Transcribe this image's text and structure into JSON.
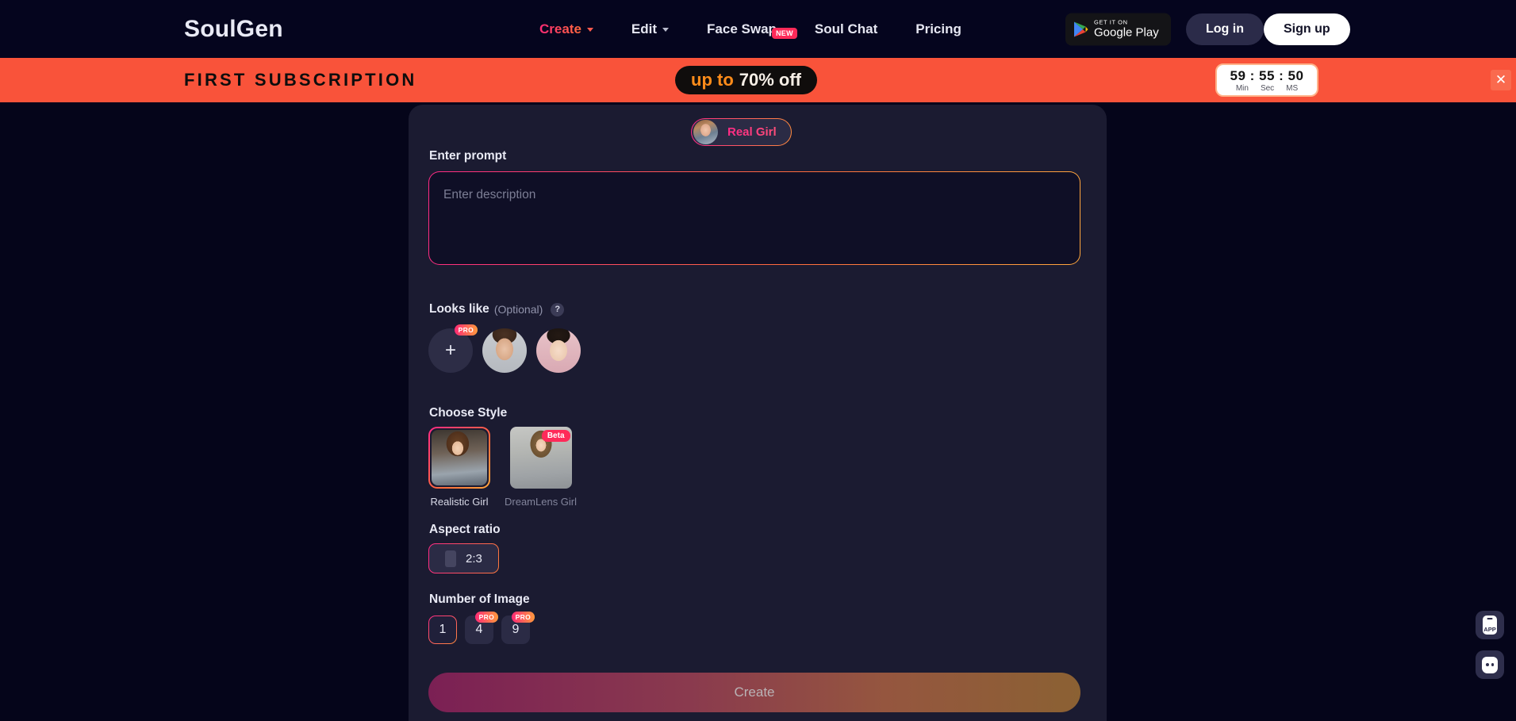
{
  "nav": {
    "brand": "SoulGen",
    "items": [
      {
        "label": "Create",
        "icon": "chevron-down-icon",
        "active": true,
        "badge": ""
      },
      {
        "label": "Edit",
        "icon": "chevron-down-icon",
        "active": false,
        "badge": ""
      },
      {
        "label": "Face Swap",
        "icon": "",
        "active": false,
        "badge": "NEW"
      },
      {
        "label": "Soul Chat",
        "icon": "",
        "active": false,
        "badge": ""
      },
      {
        "label": "Pricing",
        "icon": "",
        "active": false,
        "badge": ""
      }
    ],
    "google_play": {
      "small": "GET IT ON",
      "big": "Google Play",
      "icon": "google-play-icon"
    },
    "login": "Log in",
    "signup": "Sign up"
  },
  "promo": {
    "title": "FIRST SUBSCRIPTION",
    "pill_prefix": "up to",
    "pill_value": "70% off",
    "timer": {
      "value": "59 : 55 : 50",
      "labels": [
        "Min",
        "Sec",
        "MS"
      ]
    },
    "close_icon": "close-icon",
    "background": "#f9533a"
  },
  "panel": {
    "mode_tab": {
      "label": "Real Girl",
      "thumb": "real-girl-thumbnail"
    },
    "prompt": {
      "label": "Enter prompt",
      "placeholder": "Enter description",
      "value": ""
    },
    "looks_like": {
      "label": "Looks like",
      "optional": "(Optional)",
      "help_icon": "question-mark-icon",
      "add_icon": "plus-icon",
      "add_badge": "PRO",
      "avatars": [
        "avatar-brunette",
        "avatar-asian"
      ]
    },
    "choose_style": {
      "label": "Choose Style",
      "options": [
        {
          "name": "Realistic Girl",
          "badge": "",
          "selected": true
        },
        {
          "name": "DreamLens Girl",
          "badge": "Beta",
          "selected": false
        }
      ]
    },
    "aspect_ratio": {
      "label": "Aspect ratio",
      "options": [
        {
          "value": "2:3",
          "selected": true
        }
      ]
    },
    "number_of_image": {
      "label": "Number of Image",
      "options": [
        {
          "value": "1",
          "badge": "",
          "selected": true
        },
        {
          "value": "4",
          "badge": "PRO",
          "selected": false
        },
        {
          "value": "9",
          "badge": "PRO",
          "selected": false
        }
      ]
    },
    "create_button": "Create"
  },
  "floating": {
    "app_button": {
      "label": "APP",
      "icon": "mobile-app-icon"
    },
    "chat_button": {
      "icon": "chat-bubble-icon"
    }
  },
  "colors": {
    "page_background": "#05051a",
    "panel_background": "#1b1b31",
    "accent_pink": "#ff2a85",
    "accent_orange": "#ff7a3d",
    "promo_orange": "#f9533a"
  }
}
